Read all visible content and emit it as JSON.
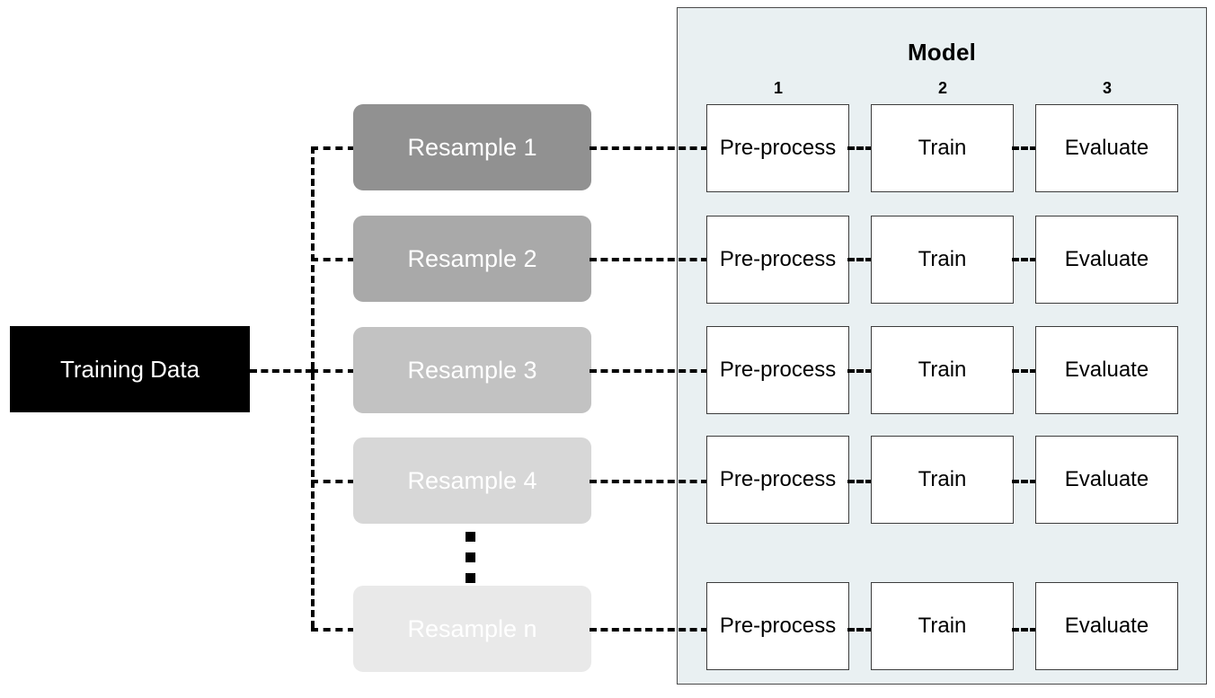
{
  "diagram": {
    "title_of_source": "Training Data",
    "panel": {
      "heading": "Model",
      "background_color": "#e9f0f2",
      "border_color": "#4a4a4a",
      "column_numbers": [
        "1",
        "2",
        "3"
      ],
      "column_labels": [
        "Pre-process",
        "Train",
        "Evaluate"
      ]
    },
    "resamples": [
      {
        "label": "Resample 1",
        "color": "#919191"
      },
      {
        "label": "Resample 2",
        "color": "#a9a9a9"
      },
      {
        "label": "Resample 3",
        "color": "#c2c2c2"
      },
      {
        "label": "Resample 4",
        "color": "#d7d7d7"
      },
      {
        "label": "Resample n",
        "color": "#e9e9e9"
      }
    ],
    "rows": [
      {
        "resample_index": 0,
        "stages": [
          "Pre-process",
          "Train",
          "Evaluate"
        ]
      },
      {
        "resample_index": 1,
        "stages": [
          "Pre-process",
          "Train",
          "Evaluate"
        ]
      },
      {
        "resample_index": 2,
        "stages": [
          "Pre-process",
          "Train",
          "Evaluate"
        ]
      },
      {
        "resample_index": 3,
        "stages": [
          "Pre-process",
          "Train",
          "Evaluate"
        ]
      },
      {
        "resample_index": 4,
        "stages": [
          "Pre-process",
          "Train",
          "Evaluate"
        ]
      }
    ],
    "ellipsis": "⋮",
    "colors": {
      "source_fill": "#000000",
      "source_text": "#ffffff",
      "connector": "#000000",
      "stage_fill": "#ffffff",
      "stage_border": "#3c3c3c"
    }
  }
}
